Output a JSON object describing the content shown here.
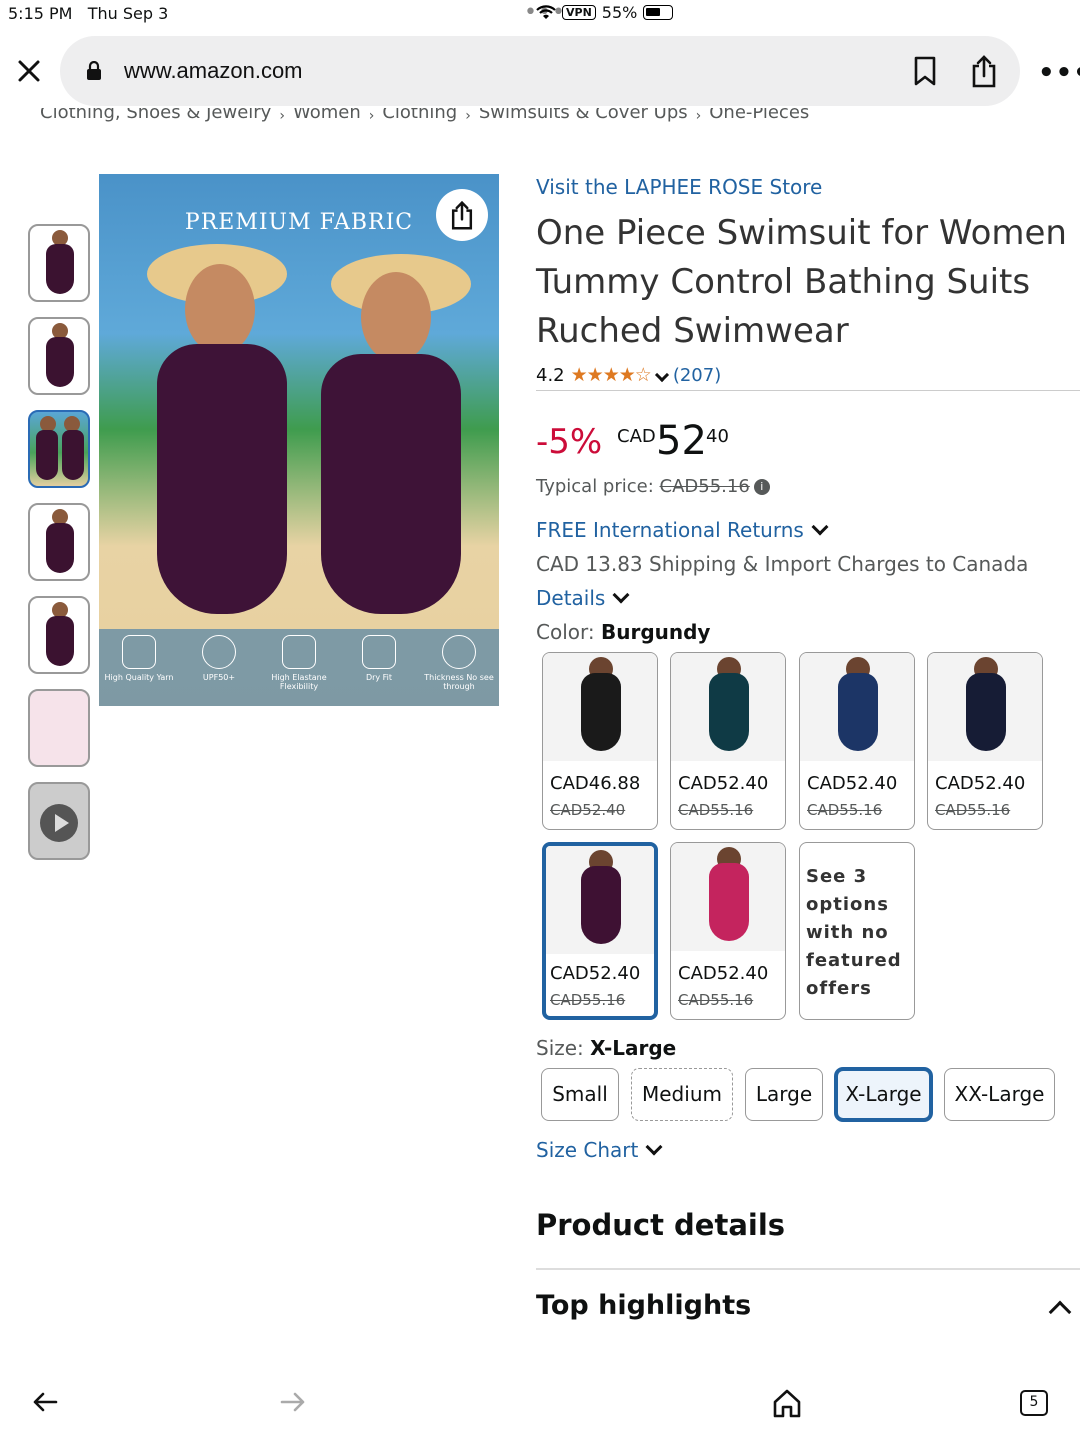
{
  "status_bar": {
    "time": "5:15 PM",
    "date": "Thu Sep 3",
    "vpn": "VPN",
    "battery": "55%"
  },
  "browser": {
    "url": "www.amazon.com"
  },
  "breadcrumb": [
    "Clothing, Shoes & Jewelry",
    "Women",
    "Clothing",
    "Swimsuits & Cover Ups",
    "One-Pieces"
  ],
  "image": {
    "banner": "PREMIUM FABRIC",
    "features": [
      "High Quality Yarn",
      "UPF50+",
      "High Elastane Flexibility",
      "Dry Fit",
      "Thickness No see through"
    ]
  },
  "product": {
    "store_link": "Visit the LAPHEE ROSE Store",
    "title": "One Piece Swimsuit for Women Tummy Control Bathing Suits Ruched Swimwear",
    "rating": "4.2",
    "stars": "★★★★☆",
    "review_count": "(207)",
    "discount": "-5%",
    "currency": "CAD",
    "price_whole": "52",
    "price_fraction": "40",
    "typical_label": "Typical price:",
    "typical_price": "CAD55.16",
    "returns": "FREE International Returns",
    "shipping": "CAD 13.83 Shipping & Import Charges to Canada",
    "details_link": "Details",
    "color_label": "Color:",
    "color_value": "Burgundy",
    "colors": [
      {
        "price": "CAD46.88",
        "old": "CAD52.40",
        "color": "#1a1a1a"
      },
      {
        "price": "CAD52.40",
        "old": "CAD55.16",
        "color": "#0f3a45"
      },
      {
        "price": "CAD52.40",
        "old": "CAD55.16",
        "color": "#1c3566"
      },
      {
        "price": "CAD52.40",
        "old": "CAD55.16",
        "color": "#161c35"
      },
      {
        "price": "CAD52.40",
        "old": "CAD55.16",
        "color": "#3e1133"
      },
      {
        "price": "CAD52.40",
        "old": "CAD55.16",
        "color": "#c4245e"
      }
    ],
    "more_options": [
      "See 3",
      "options",
      "with no",
      "featured",
      "offers"
    ],
    "size_label": "Size:",
    "size_value": "X-Large",
    "sizes": [
      "Small",
      "Medium",
      "Large",
      "X-Large",
      "XX-Large"
    ],
    "size_chart": "Size Chart",
    "product_details": "Product details",
    "top_highlights": "Top highlights"
  },
  "toolbar": {
    "tab_count": "5"
  }
}
